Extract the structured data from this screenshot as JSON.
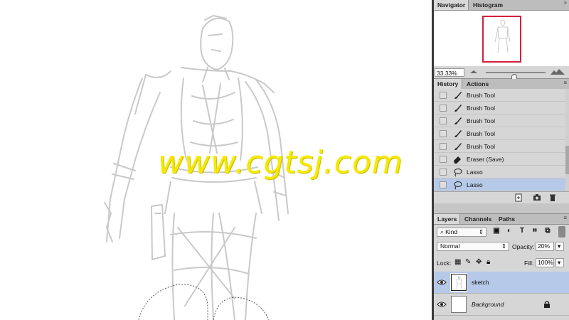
{
  "canvas": {
    "watermark": "www.cgtsj.com"
  },
  "navigator": {
    "tabs": [
      "Navigator",
      "Histogram"
    ],
    "zoom": "33.33%",
    "zoom_slider_fraction": 0.48
  },
  "history": {
    "tabs": [
      "History",
      "Actions"
    ],
    "items": [
      {
        "label": "Brush Tool",
        "icon": "brush-icon",
        "selected": false
      },
      {
        "label": "Brush Tool",
        "icon": "brush-icon",
        "selected": false
      },
      {
        "label": "Brush Tool",
        "icon": "brush-icon",
        "selected": false
      },
      {
        "label": "Brush Tool",
        "icon": "brush-icon",
        "selected": false
      },
      {
        "label": "Brush Tool",
        "icon": "brush-icon",
        "selected": false
      },
      {
        "label": "Eraser (Save)",
        "icon": "eraser-icon",
        "selected": false
      },
      {
        "label": "Lasso",
        "icon": "lasso-icon",
        "selected": false
      },
      {
        "label": "Lasso",
        "icon": "lasso-icon",
        "selected": true
      }
    ]
  },
  "layers": {
    "tabs": [
      "Layers",
      "Channels",
      "Paths"
    ],
    "filter_kind": "Kind",
    "blend_mode": "Normal",
    "opacity_label": "Opacity:",
    "opacity_value": "20%",
    "lock_label": "Lock:",
    "fill_label": "Fill:",
    "fill_value": "100%",
    "items": [
      {
        "name": "sketch",
        "selected": true,
        "italic": false,
        "locked": false
      },
      {
        "name": "Background",
        "selected": false,
        "italic": true,
        "locked": true
      }
    ]
  },
  "colors": {
    "selection": "#b6c9e8",
    "watermark": "#f6e900",
    "navigator_frame": "#d2203c"
  }
}
